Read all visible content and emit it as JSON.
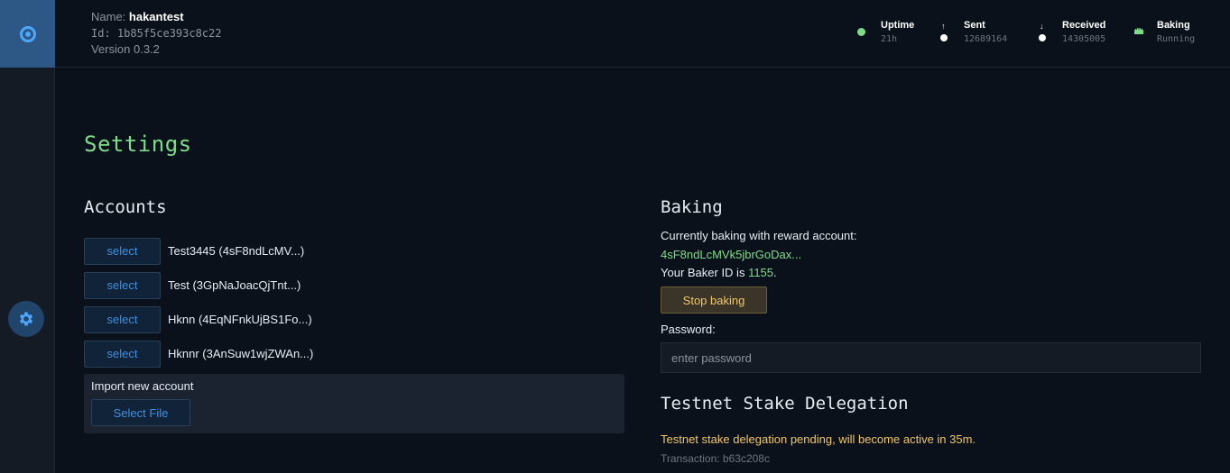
{
  "header": {
    "name_label": "Name: ",
    "name_value": "hakantest",
    "id_text": "Id: 1b85f5ce393c8c22",
    "version_text": "Version 0.3.2",
    "stats": {
      "uptime": {
        "label": "Uptime",
        "value": "21h"
      },
      "sent": {
        "label": "Sent",
        "value": "12689164"
      },
      "received": {
        "label": "Received",
        "value": "14305005"
      },
      "baking": {
        "label": "Baking",
        "value": "Running"
      }
    }
  },
  "colors": {
    "accent": "#7ddc8a",
    "link": "#3d8fe0",
    "warning": "#f0c768",
    "sidebar_active": "#2d5785"
  },
  "page": {
    "title": "Settings"
  },
  "accounts": {
    "heading": "Accounts",
    "select_label": "select",
    "items": [
      {
        "name": "Test3445 (4sF8ndLcMV...)"
      },
      {
        "name": "Test (3GpNaJoacQjTnt...)"
      },
      {
        "name": "Hknn (4EqNFnkUjBS1Fo...)"
      },
      {
        "name": "Hknnr (3AnSuw1wjZWAn...)"
      }
    ],
    "import_label": "Import new account",
    "select_file_label": "Select File"
  },
  "baking": {
    "heading": "Baking",
    "status_line": "Currently baking with reward account:",
    "reward_account": "4sF8ndLcMVk5jbrGoDax...",
    "baker_id_prefix": "Your Baker ID is ",
    "baker_id": "1155",
    "baker_id_suffix": ".",
    "stop_label": "Stop baking",
    "password_label": "Password:",
    "password_placeholder": "enter password"
  },
  "delegation": {
    "heading": "Testnet Stake Delegation",
    "pending_text": "Testnet stake delegation pending, will become active in 35m.",
    "transaction_text": "Transaction: b63c208c"
  }
}
